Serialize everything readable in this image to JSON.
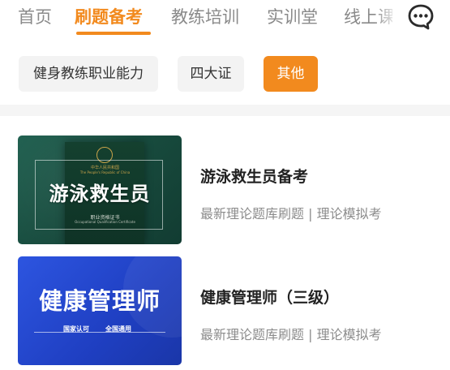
{
  "nav": {
    "tabs": [
      {
        "label": "首页"
      },
      {
        "label": "刷题备考"
      },
      {
        "label": "教练培训"
      },
      {
        "label": "实训堂"
      },
      {
        "label": "线上课"
      }
    ],
    "active_tab": "刷题备考",
    "chat_icon": "chat-bubble-icon"
  },
  "filters": {
    "chips": [
      {
        "label": "健身教练职业能力"
      },
      {
        "label": "四大证"
      },
      {
        "label": "其他"
      }
    ],
    "active": "其他"
  },
  "courses": [
    {
      "thumb_title": "游泳救生员",
      "book_top": "中华人民共和国",
      "book_top_en": "The People's Republic of China",
      "book_bottom": "职业资格证书",
      "book_bottom_en": "Occupational Qualification Certificate",
      "title": "游泳救生员备考",
      "desc": "最新理论题库刷题 | 理论模拟考"
    },
    {
      "thumb_title": "健康管理师",
      "thumb_tags": [
        "国家认可",
        "全国通用"
      ],
      "title": "健康管理师（三级）",
      "desc": "最新理论题库刷题 | 理论模拟考"
    }
  ],
  "colors": {
    "accent": "#f28a1e",
    "chip_bg": "#f3f3f3",
    "green_thumb": "#1f5f4f",
    "blue_thumb": "#2d55e0"
  }
}
